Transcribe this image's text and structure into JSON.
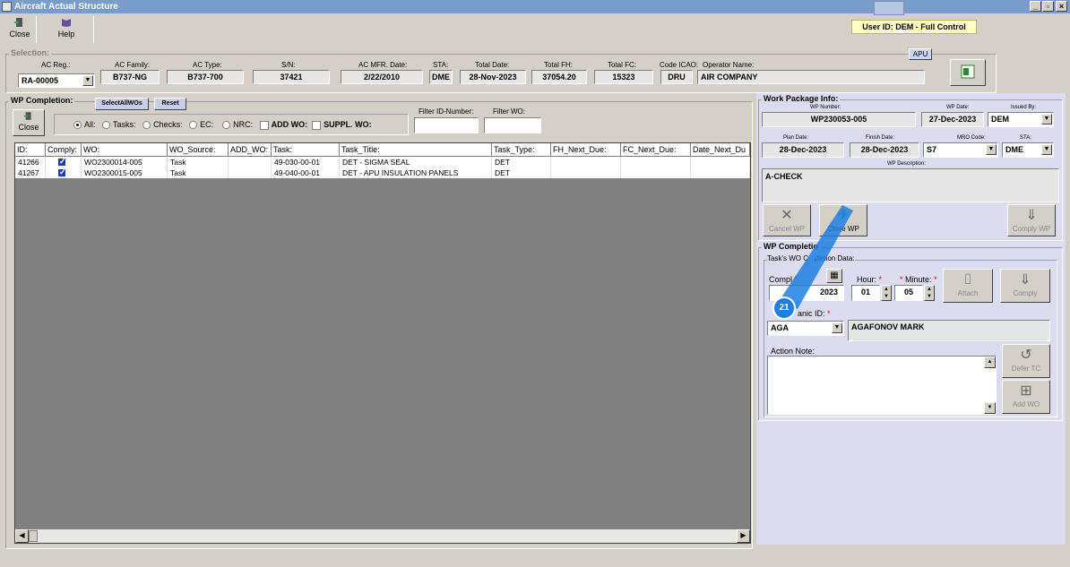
{
  "window": {
    "title": "Aircraft Actual Structure"
  },
  "toolbar": {
    "close_label": "Close",
    "help_label": "Help"
  },
  "user_info": "User ID: DEM - Full Control",
  "selection": {
    "title": "Selection:",
    "apu_label": "APU",
    "fields": {
      "ac_reg": {
        "label": "AC Reg.:",
        "value": "RA-00005"
      },
      "ac_family": {
        "label": "AC Family:",
        "value": "B737-NG"
      },
      "ac_type": {
        "label": "AC Type:",
        "value": "B737-700"
      },
      "sn": {
        "label": "S/N:",
        "value": "37421"
      },
      "mfr_date": {
        "label": "AC MFR. Date:",
        "value": "2/22/2010"
      },
      "sta": {
        "label": "STA:",
        "value": "DME"
      },
      "total_date": {
        "label": "Total Date:",
        "value": "28-Nov-2023"
      },
      "total_fh": {
        "label": "Total FH:",
        "value": "37054.20"
      },
      "total_fc": {
        "label": "Total FC:",
        "value": "15323"
      },
      "code_icao": {
        "label": "Code ICAO:",
        "value": "DRU"
      },
      "operator": {
        "label": "Operator Name:",
        "value": "AIR COMPANY"
      }
    }
  },
  "wp_completion": {
    "title": "WP Completion:",
    "select_all_label": "SelectAllWOs",
    "reset_label": "Reset",
    "close_label": "Close",
    "filters": {
      "all": "All:",
      "tasks": "Tasks:",
      "checks": "Checks:",
      "ec": "EC:",
      "nrc": "NRC:",
      "add_wo": "ADD WO:",
      "suppl_wo": "SUPPL. WO:",
      "filter_id_label": "Filter ID-Number:",
      "filter_wo_label": "Filter WO:"
    },
    "columns": [
      "ID:",
      "Comply:",
      "WO:",
      "WO_Source:",
      "ADD_WO:",
      "Task:",
      "Task_Title:",
      "Task_Type:",
      "FH_Next_Due:",
      "FC_Next_Due:",
      "Date_Next_Du"
    ],
    "rows": [
      {
        "id": "41266",
        "wo": "WO2300014-005",
        "source": "Task",
        "add_wo": "",
        "task": "49-030-00-01",
        "title": "DET - SIGMA SEAL",
        "type": "DET"
      },
      {
        "id": "41267",
        "wo": "WO2300015-005",
        "source": "Task",
        "add_wo": "",
        "task": "49-040-00-01",
        "title": "DET - APU INSULATION PANELS",
        "type": "DET"
      }
    ]
  },
  "work_package": {
    "title": "Work Package Info:",
    "wp_number_label": "WP Number:",
    "wp_number": "WP230053-005",
    "wp_date_label": "WP Date:",
    "wp_date": "27-Dec-2023",
    "issued_by_label": "Issued By:",
    "issued_by": "DEM",
    "plan_date_label": "Plan Date:",
    "plan_date": "28-Dec-2023",
    "finish_date_label": "Finish Date:",
    "finish_date": "28-Dec-2023",
    "mro_code_label": "MRO Code:",
    "mro_code": "S7",
    "sta_label": "STA:",
    "sta": "DME",
    "wp_desc_label": "WP Description:",
    "wp_desc": "A-CHECK",
    "cancel_wp": "Cancel WP",
    "close_wp": "Close WP",
    "comply_wp": "Comply WP"
  },
  "wp_completion_right": {
    "title": "WP Completio",
    "sub_title": "Task's WO C",
    "sub_title_rest": "pletion Data:",
    "complete_label": "Compl",
    "date_value": "2023",
    "hour_label": "Hour:",
    "hour": "01",
    "minute_label": "Minute:",
    "minute": "05",
    "attach": "Attach",
    "comply": "Comply",
    "mechanic_label": "anic ID:",
    "mechanic_id": "AGA",
    "mechanic_name": "AGAFONOV MARK",
    "action_note_label": "Action Note:",
    "defer_tc": "Defer TC",
    "add_wo": "Add WO"
  },
  "annotation": {
    "step": "21"
  }
}
